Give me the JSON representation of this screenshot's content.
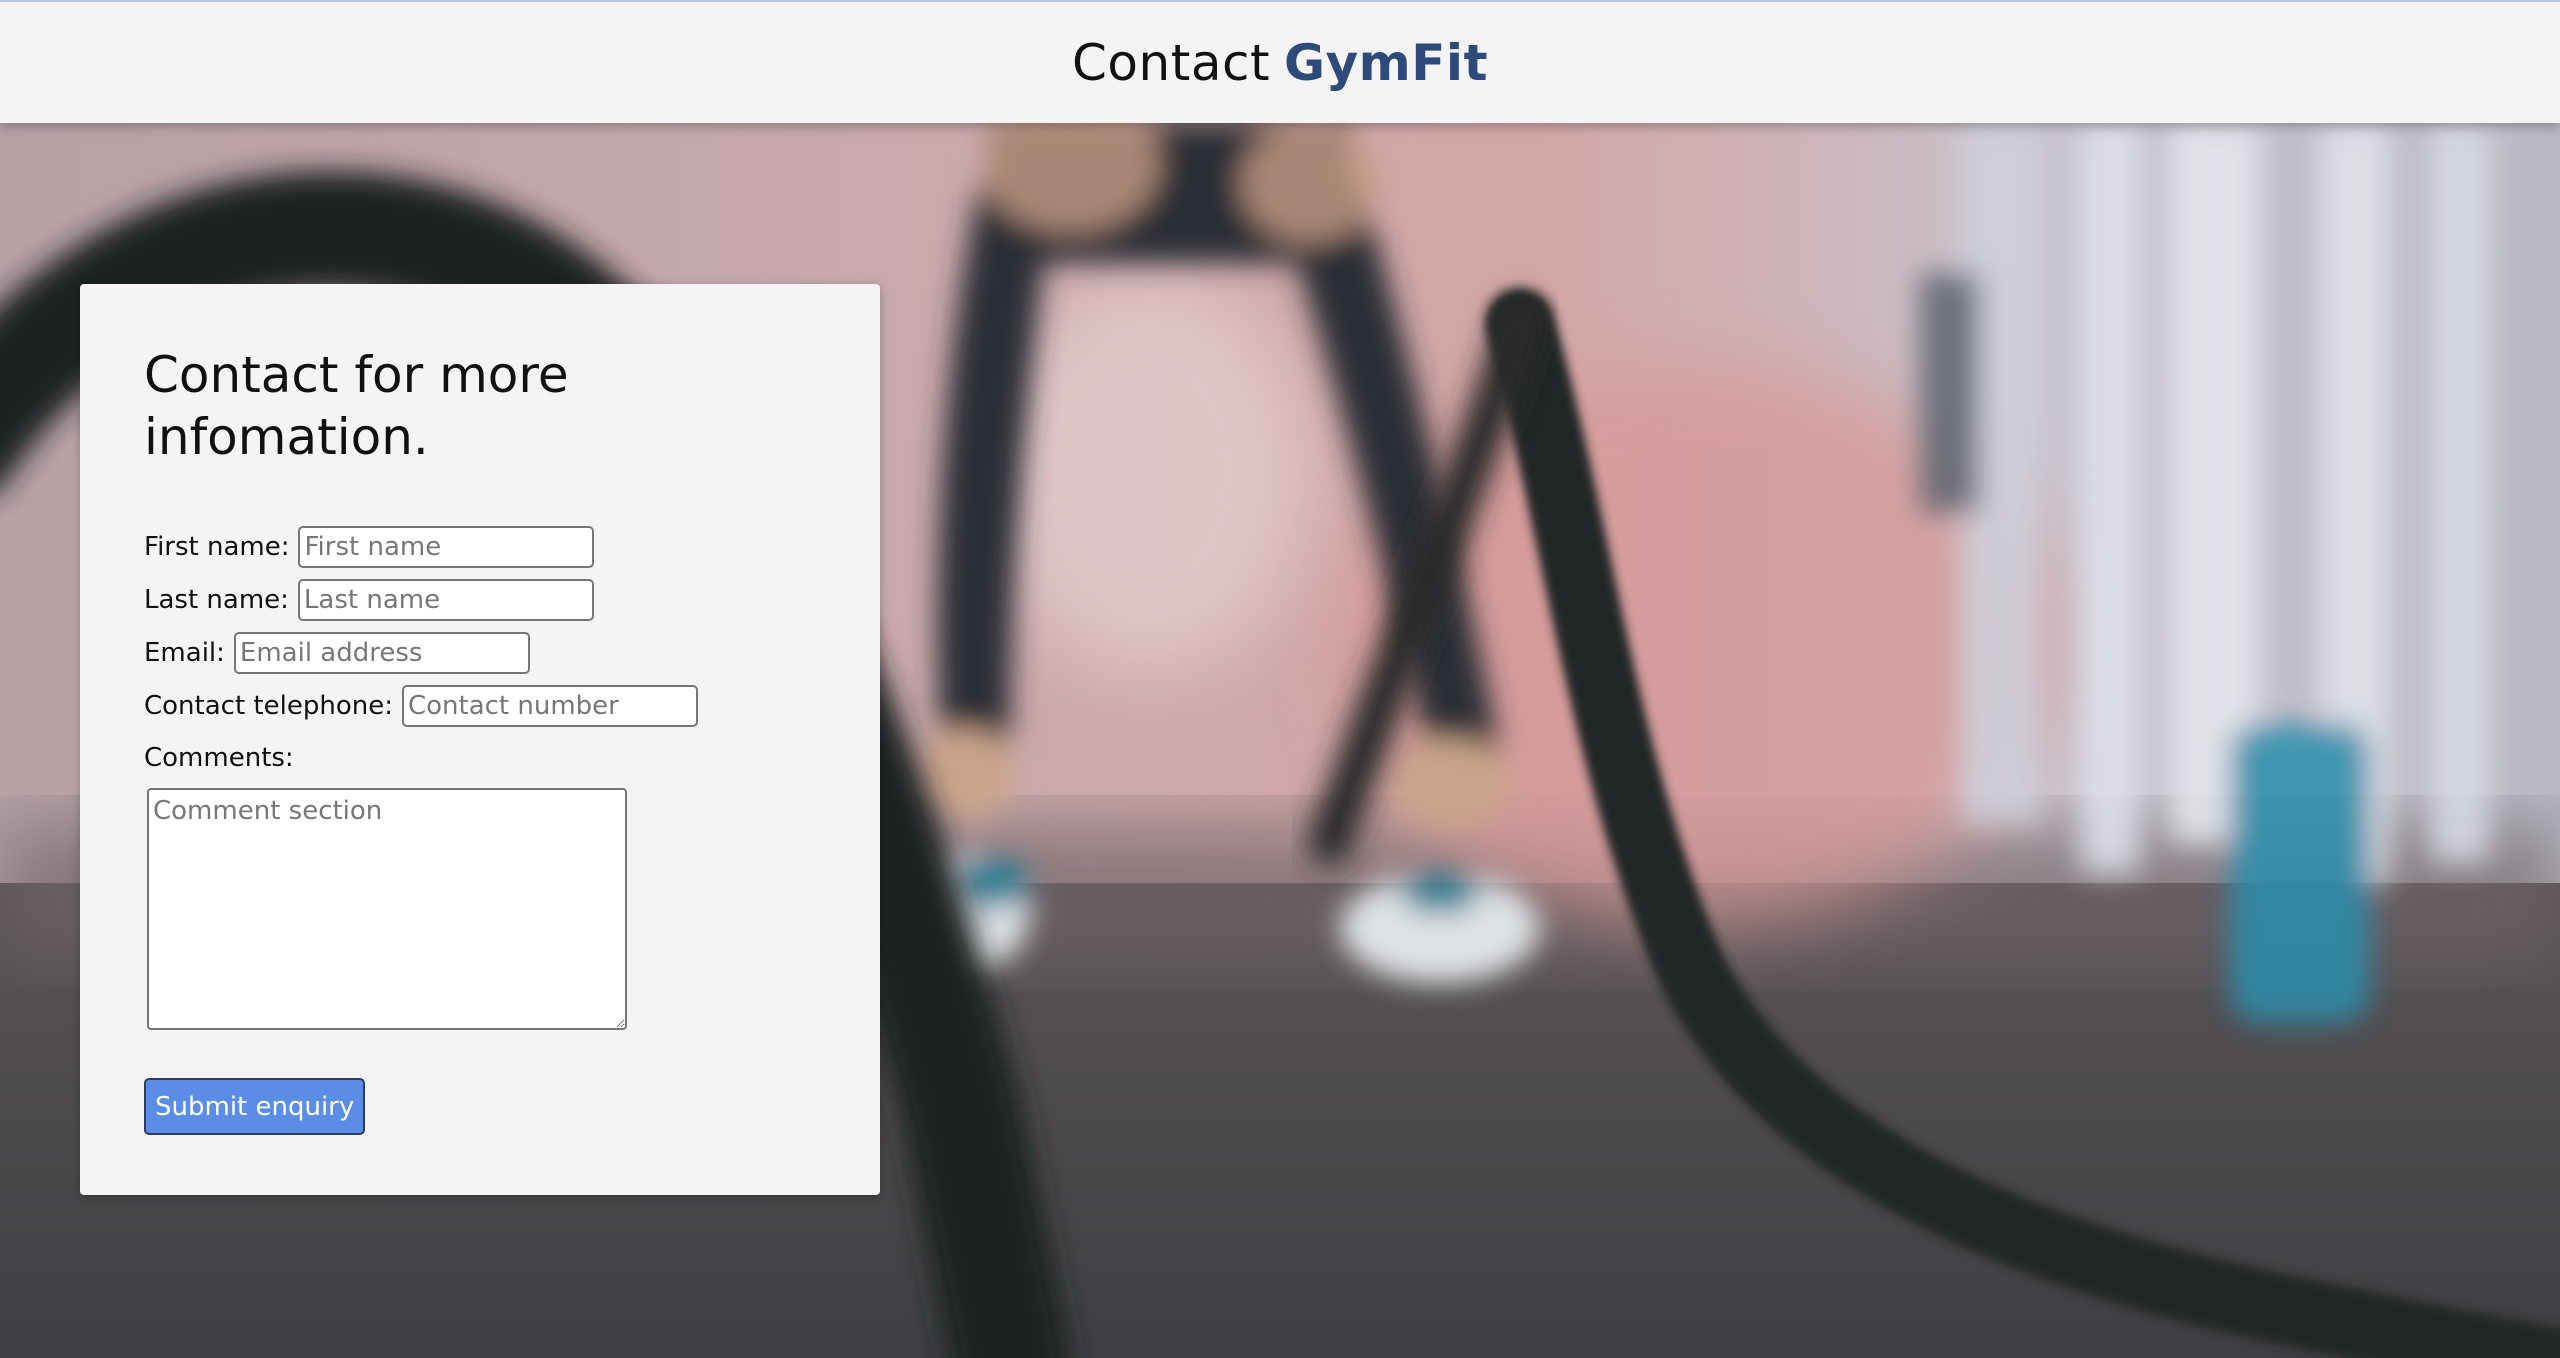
{
  "header": {
    "title_prefix": "Contact",
    "brand": "GymFit"
  },
  "colors": {
    "brand": "#2d4a7a",
    "button": "#5b8de6",
    "header_bg": "#f4f4f4",
    "card_bg": "#f4f4f4"
  },
  "form": {
    "heading": "Contact for more infomation.",
    "first_name": {
      "label": "First name:",
      "placeholder": "First name"
    },
    "last_name": {
      "label": "Last name:",
      "placeholder": "Last name"
    },
    "email": {
      "label": "Email:",
      "placeholder": "Email address"
    },
    "telephone": {
      "label": "Contact telephone:",
      "placeholder": "Contact number"
    },
    "comments": {
      "label": "Comments:",
      "placeholder": "Comment section"
    },
    "submit_label": "Submit enquiry"
  }
}
